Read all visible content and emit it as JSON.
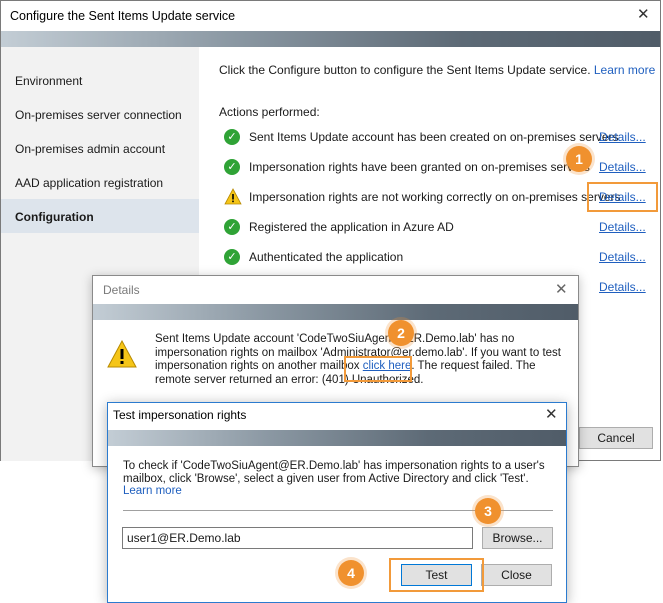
{
  "main_window": {
    "title": "Configure the Sent Items Update service",
    "close_glyph": "✕",
    "sidebar": [
      {
        "label": "Environment",
        "selected": false
      },
      {
        "label": "On-premises server connection",
        "selected": false
      },
      {
        "label": "On-premises admin account",
        "selected": false
      },
      {
        "label": "AAD application registration",
        "selected": false
      },
      {
        "label": "Configuration",
        "selected": true
      }
    ],
    "intro_text": "Click the Configure button to configure the Sent Items Update service.",
    "learn_more": "Learn more",
    "actions_label": "Actions performed:",
    "actions": [
      {
        "text": "Sent Items Update account has been created on on-premises servers",
        "status": "ok",
        "details": "Details..."
      },
      {
        "text": "Impersonation rights have been granted on on-premises servers",
        "status": "ok",
        "details": "Details..."
      },
      {
        "text": "Impersonation rights are not working correctly on on-premises servers",
        "status": "warning",
        "details": "Details..."
      },
      {
        "text": "Registered the application in Azure AD",
        "status": "ok",
        "details": "Details..."
      },
      {
        "text": "Authenticated the application",
        "status": "ok",
        "details": "Details..."
      },
      {
        "text": "",
        "status": "hidden",
        "details": "Details..."
      }
    ],
    "cancel_label": "Cancel"
  },
  "details_dialog": {
    "title": "Details",
    "close_glyph": "✕",
    "message_before": "Sent Items Update account 'CodeTwoSiuAgent@ER.Demo.lab' has no impersonation rights on mailbox 'Administrator@er.demo.lab'. If you want to test impersonation rights on another mailbox ",
    "message_link": "click here",
    "message_after": ". The request failed. The remote server returned an error: (401) Unauthorized."
  },
  "test_dialog": {
    "title": "Test impersonation rights",
    "close_glyph": "✕",
    "description": "To check if 'CodeTwoSiuAgent@ER.Demo.lab' has impersonation rights to a user's mailbox, click 'Browse', select a given user from Active Directory and click 'Test'.",
    "learn_more": "Learn more",
    "user_value": "user1@ER.Demo.lab",
    "browse_label": "Browse...",
    "test_label": "Test",
    "close_label": "Close"
  },
  "callouts": [
    "1",
    "2",
    "3",
    "4"
  ],
  "colors": {
    "accent_orange": "#f0912e",
    "link_blue": "#1f5fbf",
    "ok_green": "#2fa336",
    "warning_yellow": "#f5c518",
    "selected_item": "#dde4ec"
  },
  "icons": {
    "ok": "check-circle-icon",
    "warning": "warning-triangle-icon",
    "close": "close-icon"
  }
}
